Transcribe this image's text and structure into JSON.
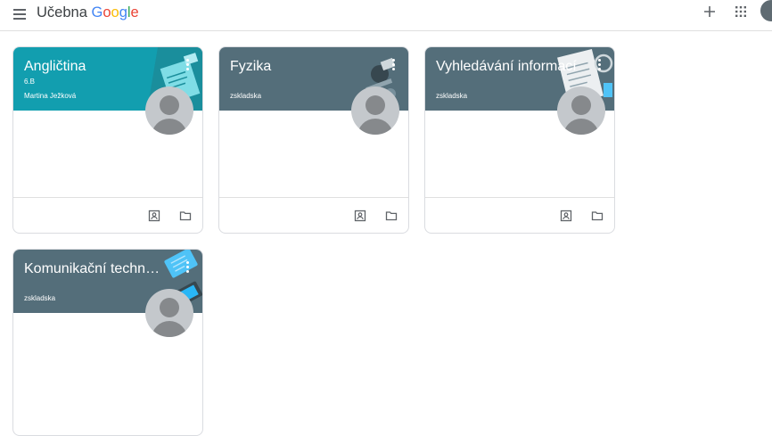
{
  "header": {
    "menu_icon": "hamburger-menu-icon",
    "brand_prefix": "Učebna",
    "brand_google": [
      "G",
      "o",
      "o",
      "g",
      "l",
      "e"
    ],
    "brand_colors": [
      "#4285F4",
      "#EA4335",
      "#FBBC05",
      "#4285F4",
      "#34A853",
      "#EA4335"
    ],
    "add_icon": "plus-icon",
    "apps_icon": "apps-grid-icon"
  },
  "colors": {
    "teal": "#129eaf",
    "slate": "#546e7a"
  },
  "classes": [
    {
      "title": "Angličtina",
      "section": "6.B",
      "teacher": "Martina Ježková",
      "banner": "teal"
    },
    {
      "title": "Fyzika",
      "section": "",
      "teacher": "zskladska",
      "banner": "slate"
    },
    {
      "title": "Vyhledávání informací",
      "section": "",
      "teacher": "zskladska",
      "banner": "slate"
    },
    {
      "title": "Komunikační technologie",
      "section": "",
      "teacher": "zskladska",
      "banner": "slate"
    }
  ],
  "card_actions": [
    "assignments-icon",
    "folder-icon"
  ]
}
